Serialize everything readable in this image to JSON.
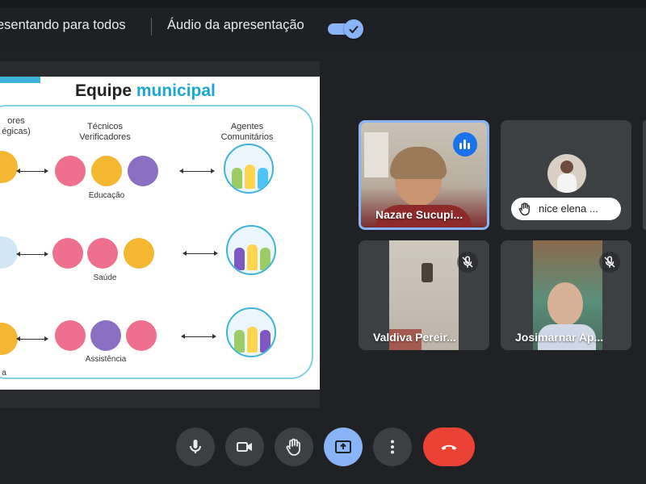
{
  "topbar": {
    "presenting_text": "esentando para todos",
    "audio_label": "Áudio da apresentação",
    "audio_toggle_on": true
  },
  "slide": {
    "title_part1": "Equipe",
    "title_part2": "municipal",
    "col1_head_line1": "ores",
    "col1_head_line2": "égicas)",
    "col2_head_line1": "Técnicos",
    "col2_head_line2": "Verificadores",
    "col3_head_line1": "Agentes",
    "col3_head_line2": "Comunitários",
    "row1_category": "Educação",
    "row2_category": "Saúde",
    "row3_category": "Assistência",
    "row3_left_fragment": "a"
  },
  "participants": [
    {
      "name": "Nazare Sucupi...",
      "speaking": true,
      "active": true
    },
    {
      "name": "nice elena ...",
      "hand_raised": true
    },
    {
      "name": "Valdiva Pereir...",
      "muted": true
    },
    {
      "name": "Josimarnar Ap...",
      "muted": true
    }
  ],
  "controls": {
    "mic": "mic-icon",
    "camera": "camera-icon",
    "raise_hand": "raise-hand-icon",
    "present": "present-screen-icon",
    "more": "more-options-icon",
    "hangup": "end-call-icon"
  },
  "colors": {
    "accent": "#8ab4f8",
    "hangup": "#ea4335",
    "speaking": "#1a73e8",
    "slide_title_highlight": "#1aa7d4"
  }
}
